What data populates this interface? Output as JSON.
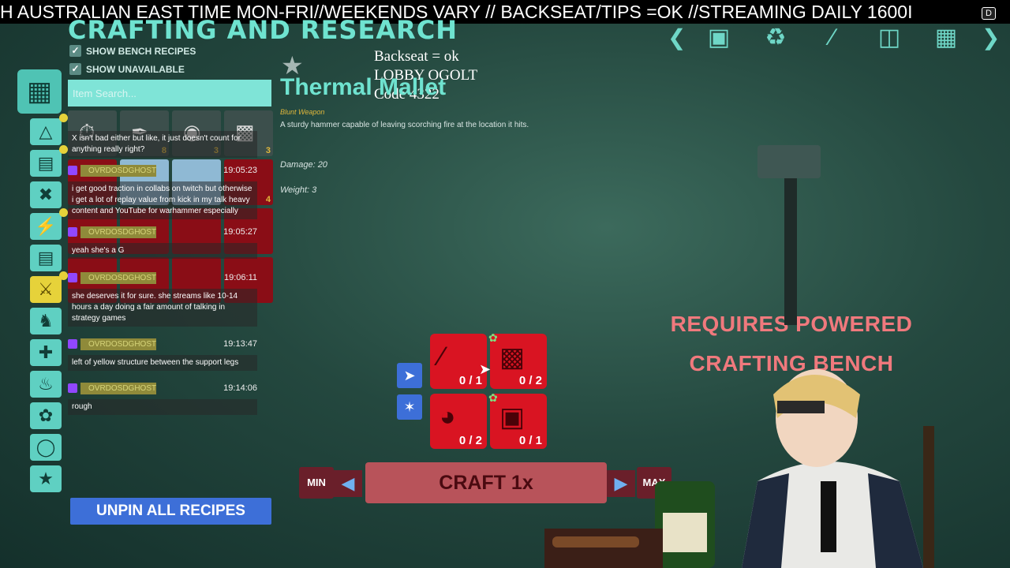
{
  "ticker": {
    "text": "H AUSTRALIAN EAST TIME MON-FRI//WEEKENDS VARY //  BACKSEAT/TIPS =OK //STREAMING DAILY 1600I",
    "badge": "D"
  },
  "header": {
    "title": "CRAFTING AND RESEARCH",
    "nav_icons": [
      "backpack-icon",
      "outfit-icon",
      "ruler-icon",
      "terminal-icon",
      "blueprint-icon"
    ]
  },
  "filters": {
    "show_bench_recipes": "SHOW BENCH RECIPES",
    "show_unavailable": "SHOW UNAVAILABLE"
  },
  "search": {
    "placeholder": "Item Search..."
  },
  "grid_counts": [
    "",
    "8",
    "3",
    "3",
    "",
    "",
    "",
    "4"
  ],
  "chat": [
    {
      "text": "X isn't bad either but like, it just doesn't count for anything really right?"
    },
    {
      "user": "OVRDOSDGHOST",
      "time": "19:05:23",
      "text": "i get good traction in collabs on twitch but otherwise i get a lot of replay value from kick in my talk heavy content and YouTube for warhammer especially"
    },
    {
      "user": "OVRDOSDGHOST",
      "time": "19:05:27",
      "text": "yeah she's a G"
    },
    {
      "user": "OVRDOSDGHOST",
      "time": "19:06:11",
      "text": "she deserves it for sure. she streams like 10-14 hours a day doing a fair amount of talking in strategy games"
    },
    {
      "user": "OVRDOSDGHOST",
      "time": "19:13:47",
      "text": "left of yellow structure between the support legs"
    },
    {
      "user": "OVRDOSDGHOST",
      "time": "19:14:06",
      "text": "rough"
    }
  ],
  "unpin_label": "UNPIN ALL RECIPES",
  "overlay": {
    "line1": "Backseat = ok",
    "line2": "LOBBY OGOLT",
    "line3": "Code 4322"
  },
  "item": {
    "name": "Thermal Mallet",
    "type": "Blunt Weapon",
    "description": "A sturdy hammer capable of leaving scorching fire at the location it hits.",
    "damage": "Damage: 20",
    "weight": "Weight: 3"
  },
  "ingredients": [
    {
      "qty": "0 / 1"
    },
    {
      "qty": "0 / 2"
    },
    {
      "qty": "0 / 2"
    },
    {
      "qty": "0 / 1"
    }
  ],
  "craft": {
    "min": "MIN",
    "max": "MAX",
    "label": "CRAFT 1x"
  },
  "requirement": {
    "line1": "REQUIRES POWERED",
    "line2": "CRAFTING BENCH"
  }
}
